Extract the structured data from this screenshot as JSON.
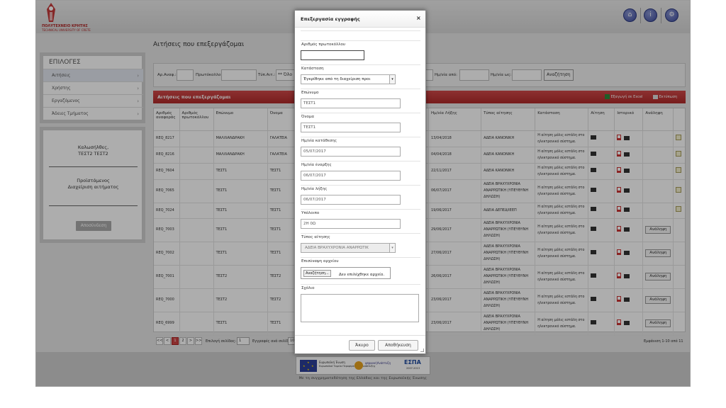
{
  "header": {
    "logo_line1": "ΠΟΛΥΤΕΧΝΕΙΟ ΚΡΗΤΗΣ",
    "logo_line2": "TECHNICAL UNIVERSITY OF CRETE",
    "icons": [
      "home-icon",
      "info-icon",
      "settings-icon"
    ]
  },
  "sidebar": {
    "title": "ΕΠΙΛΟΓΕΣ",
    "items": [
      {
        "label": "Αιτήσεις",
        "chevron": "›"
      },
      {
        "label": "Χρήστης",
        "chevron": "›"
      },
      {
        "label": "Εργαζόμενος",
        "chevron": "›"
      },
      {
        "label": "Άδειες Τμήματος",
        "chevron": "›"
      }
    ]
  },
  "userbox": {
    "greeting": "Καλωσήλθες,",
    "user": "ΤΕΣΤ2 ΤΕΣΤ2",
    "role": "Προϊστάμενος",
    "role_desc": "Διαχείριση αιτήματος",
    "logout": "Αποσύνδεση"
  },
  "page": {
    "title": "Αιτήσεις που επεξεργάζομαι"
  },
  "filter": {
    "ref_label": "Αρ.Αναφ.:",
    "protocol_label": "Πρωτόκολλο:",
    "type_label": "Τύπ.Αιτ.:",
    "type_value": "** Όλο",
    "from_label": "Ημ/νία από:",
    "to_label": "Ημ/νία ως:",
    "search_button": "Αναζήτηση"
  },
  "table_header": {
    "title": "Αιτήσεις που επεξεργάζομαι",
    "excel": "Εξαγωγή σε Excel",
    "print": "Εκτύπωση"
  },
  "table": {
    "columns": [
      "Αριθμός αναφοράς",
      "Αριθμός πρωτοκόλλου",
      "Επώνυμο",
      "Όνομα",
      "Ημ/νία Λήξης",
      "Τύπος αίτησης",
      "Κατάσταση",
      "Αίτηση",
      "Ιστορικό",
      "Ανάληψη"
    ],
    "rows": [
      {
        "ref": "REQ_8217",
        "surname": "ΜΑΛΛΙΑΝΔΡΑΚΗ",
        "name": "ΓΑΛΑΤΕΙΑ",
        "end": "13/04/2018",
        "type": "ΑΔΕΙΑ ΚΑΝΟΝΙΚΗ",
        "state": "Η αίτηση μόλις εστάλη στο ηλεκτρονικό σύστημα.",
        "action": "edit"
      },
      {
        "ref": "REQ_8216",
        "surname": "ΜΑΛΛΙΑΝΔΡΑΚΗ",
        "name": "ΓΑΛΑΤΕΙΑ",
        "end": "04/04/2018",
        "type": "ΑΔΕΙΑ ΚΑΝΟΝΙΚΗ",
        "state": "Η αίτηση μόλις εστάλη στο ηλεκτρονικό σύστημα.",
        "action": "edit"
      },
      {
        "ref": "REQ_7604",
        "surname": "ΤΕΣΤ1",
        "name": "ΤΕΣΤ1",
        "end": "22/11/2017",
        "type": "ΑΔΕΙΑ ΚΑΝΟΝΙΚΗ",
        "state": "Η αίτηση μόλις εστάλη στο ηλεκτρονικό σύστημα.",
        "action": "edit"
      },
      {
        "ref": "REQ_7065",
        "surname": "ΤΕΣΤ1",
        "name": "ΤΕΣΤ1",
        "end": "06/07/2017",
        "type": "ΑΔΕΙΑ ΒΡΑΧΥΧΡΟΝΙΑ ΑΝΑΡΡΩΤΙΚΗ (ΥΠΕΥΘΥΝΗ ΔΗΛΩΣΗ)",
        "state": "Η αίτηση μόλις εστάλη στο ηλεκτρονικό σύστημα.",
        "action": "edit"
      },
      {
        "ref": "REQ_7024",
        "surname": "ΤΕΣΤ1",
        "name": "ΤΕΣΤ1",
        "end": "19/06/2017",
        "type": "ΑΔΕΙΑ ΔΕΠΕΔ/ΙΕΕΠ",
        "state": "Η αίτηση μόλις εστάλη στο ηλεκτρονικό σύστημα.",
        "action": "edit"
      },
      {
        "ref": "REQ_7003",
        "surname": "ΤΕΣΤ1",
        "name": "ΤΕΣΤ1",
        "end": "29/06/2017",
        "type": "ΑΔΕΙΑ ΒΡΑΧΥΧΡΟΝΙΑ ΑΝΑΡΡΩΤΙΚΗ (ΥΠΕΥΘΥΝΗ ΔΗΛΩΣΗ)",
        "state": "Η αίτηση μόλις εστάλη στο ηλεκτρονικό σύστημα.",
        "action": "Ανάληψη"
      },
      {
        "ref": "REQ_7002",
        "surname": "ΤΕΣΤ1",
        "name": "ΤΕΣΤ1",
        "end": "27/06/2017",
        "type": "ΑΔΕΙΑ ΒΡΑΧΥΧΡΟΝΙΑ ΑΝΑΡΡΩΤΙΚΗ (ΥΠΕΥΘΥΝΗ ΔΗΛΩΣΗ)",
        "state": "Η αίτηση μόλις εστάλη στο ηλεκτρονικό σύστημα.",
        "action": "Ανάληψη"
      },
      {
        "ref": "REQ_7001",
        "surname": "ΤΕΣΤ2",
        "name": "ΤΕΣΤ2",
        "end": "26/06/2017",
        "type": "ΑΔΕΙΑ ΒΡΑΧΥΧΡΟΝΙΑ ΑΝΑΡΡΩΤΙΚΗ (ΥΠΕΥΘΥΝΗ ΔΗΛΩΣΗ)",
        "state": "Η αίτηση μόλις εστάλη στο ηλεκτρονικό σύστημα.",
        "action": "Ανάληψη"
      },
      {
        "ref": "REQ_7000",
        "surname": "ΤΕΣΤ2",
        "name": "ΤΕΣΤ2",
        "end": "23/06/2017",
        "type": "ΑΔΕΙΑ ΒΡΑΧΥΧΡΟΝΙΑ ΑΝΑΡΡΩΤΙΚΗ (ΥΠΕΥΘΥΝΗ ΔΗΛΩΣΗ)",
        "state": "Η αίτηση μόλις εστάλη στο ηλεκτρονικό σύστημα.",
        "action": "Ανάληψη"
      },
      {
        "ref": "REQ_6999",
        "surname": "ΤΕΣΤ1",
        "name": "ΤΕΣΤ1",
        "end": "23/06/2017",
        "type": "ΑΔΕΙΑ ΒΡΑΧΥΧΡΟΝΙΑ ΑΝΑΡΡΩΤΙΚΗ (ΥΠΕΥΘΥΝΗ ΔΗΛΩΣΗ)",
        "state": "Η αίτηση μόλις εστάλη στο ηλεκτρονικό σύστημα.",
        "action": "Ανάληψη"
      }
    ]
  },
  "pager": {
    "buttons": [
      "<<",
      "<",
      "1",
      "2",
      ">",
      ">>"
    ],
    "page_label": "Επιλογή σελίδας:",
    "page_value": "1",
    "per_page_label": "Εγγραφές ανά σελίδα:",
    "per_page_value": "10",
    "summary": "Εμφάνιση 1-10 από 11"
  },
  "footer": {
    "eu_label": "Ευρωπαϊκή Ένωση",
    "eu_sub": "Ευρωπαϊκό Ταμείο Περιφερειακής Ανάπτυξης",
    "digital_label": "ψηφιακήΑνάπτυξη",
    "espa": "ΕΣΠΑ",
    "espa_years": "2007-2013",
    "caption": "Με τη συγχρηματοδότηση της Ελλάδας και της Ευρωπαϊκής Ένωσης"
  },
  "modal": {
    "title": "Επεξεργασία εγγραφής",
    "close": "×",
    "fields": {
      "protocol_label": "Αριθμός πρωτοκόλλου",
      "protocol_value": "",
      "status_label": "Κατάσταση",
      "status_value": "Έγκρίθηκε από τη διαχείριση προι",
      "surname_label": "Επώνυμο",
      "surname_value": "ΤΕΣΤ1",
      "name_label": "Όνομα",
      "name_value": "ΤΕΣΤ1",
      "filed_label": "Ημ/νία κατάθεσης",
      "filed_value": "05/07/2017",
      "start_label": "Ημ/νία έναρξης",
      "start_value": "06/07/2017",
      "end_label": "Ημ/νία λήξης",
      "end_value": "06/07/2017",
      "balance_label": "Υπόλοιπο",
      "balance_value": "2Η 0Ω",
      "type_label": "Τύπος αίτησης",
      "type_value": "ΑΔΕΙΑ ΒΡΑΧΥΧΡΟΝΙΑ ΑΝΑΡΡΩΤΙΚ",
      "attach_label": "Επισύναψη αρχείου",
      "browse": "Αναζήτηση...",
      "no_file": "Δεν επιλέχθηκε αρχείο.",
      "comment_label": "Σχόλιο"
    },
    "cancel": "Άκυρο",
    "save": "Αποθήκευση"
  },
  "colors": {
    "accent_red": "#b22a2a",
    "header_bar": "#c03a3a",
    "icon_blue": "#3d4c9e"
  }
}
